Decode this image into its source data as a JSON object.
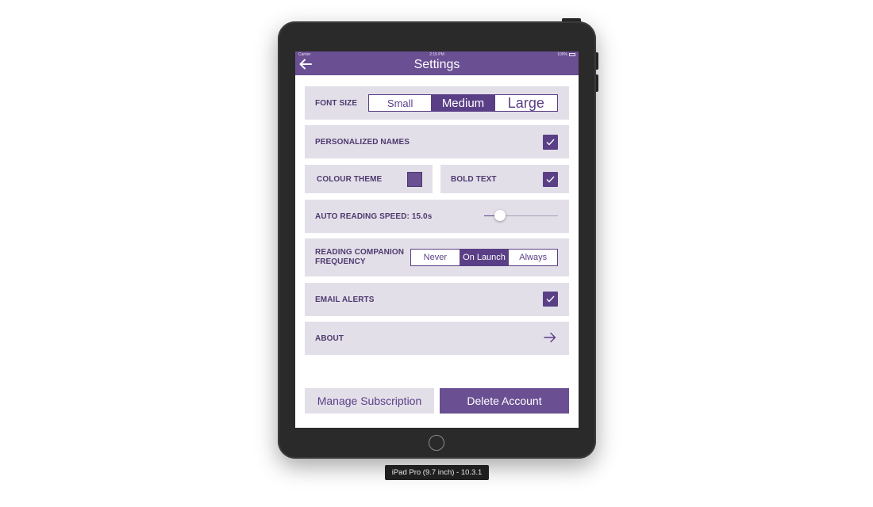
{
  "status_bar": {
    "carrier": "Carrier",
    "time": "2:15 PM",
    "battery": "100%"
  },
  "nav": {
    "title": "Settings"
  },
  "font_size": {
    "label": "FONT SIZE",
    "options": [
      "Small",
      "Medium",
      "Large"
    ],
    "selected": "Medium"
  },
  "personalized_names": {
    "label": "PERSONALIZED NAMES",
    "checked": true
  },
  "colour_theme": {
    "label": "COLOUR THEME",
    "swatch_color": "#6a4f93"
  },
  "bold_text": {
    "label": "BOLD TEXT",
    "checked": true
  },
  "auto_reading": {
    "label": "AUTO READING SPEED: 15.0s",
    "slider_fraction": 0.22
  },
  "reading_companion": {
    "label": "READING COMPANION FREQUENCY",
    "options": [
      "Never",
      "On Launch",
      "Always"
    ],
    "selected": "On Launch"
  },
  "email_alerts": {
    "label": "EMAIL ALERTS",
    "checked": true
  },
  "about": {
    "label": "ABOUT"
  },
  "buttons": {
    "manage": "Manage Subscription",
    "delete": "Delete Account"
  },
  "device_label": "iPad Pro (9.7 inch) - 10.3.1",
  "colors": {
    "accent": "#5a3f86",
    "nav_bg": "#6a4f93",
    "row_bg": "#e3dfe9"
  }
}
